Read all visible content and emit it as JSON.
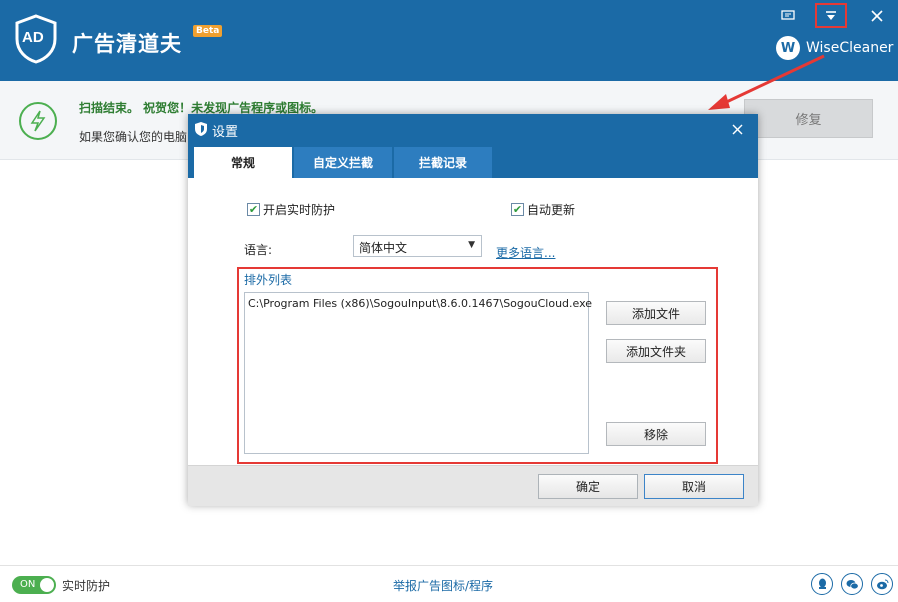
{
  "app": {
    "title": "广告清道夫",
    "badge": "Beta",
    "logo_text": "AD",
    "brand": "WiseCleaner",
    "brand_letter": "W"
  },
  "window_controls": [
    "feedback-icon",
    "menu-dropdown-icon",
    "close-icon"
  ],
  "result": {
    "title": "扫描结束。 祝贺您！未发现广告程序或图标。",
    "subtitle": "如果您确认您的电脑",
    "repair_button": "修复"
  },
  "dialog": {
    "title": "设置",
    "tabs": [
      {
        "label": "常规"
      },
      {
        "label": "自定义拦截"
      },
      {
        "label": "拦截记录"
      }
    ],
    "active_tab": "常规",
    "realtime_protection": {
      "label": "开启实时防护",
      "checked": true
    },
    "auto_update": {
      "label": "自动更新",
      "checked": true
    },
    "language": {
      "label": "语言:",
      "value": "简体中文",
      "more_link": "更多语言..."
    },
    "exclusion": {
      "title": "排外列表",
      "items": [
        "C:\\Program Files (x86)\\SogouInput\\8.6.0.1467\\SogouCloud.exe"
      ],
      "add_file": "添加文件",
      "add_folder": "添加文件夹",
      "remove": "移除"
    },
    "ok": "确定",
    "cancel": "取消"
  },
  "footer": {
    "toggle": "ON",
    "realtime_label": "实时防护",
    "report_link": "举报广告图标/程序"
  },
  "colors": {
    "primary": "#1b6aa6",
    "success": "#4caf50",
    "highlight": "#e53935"
  }
}
